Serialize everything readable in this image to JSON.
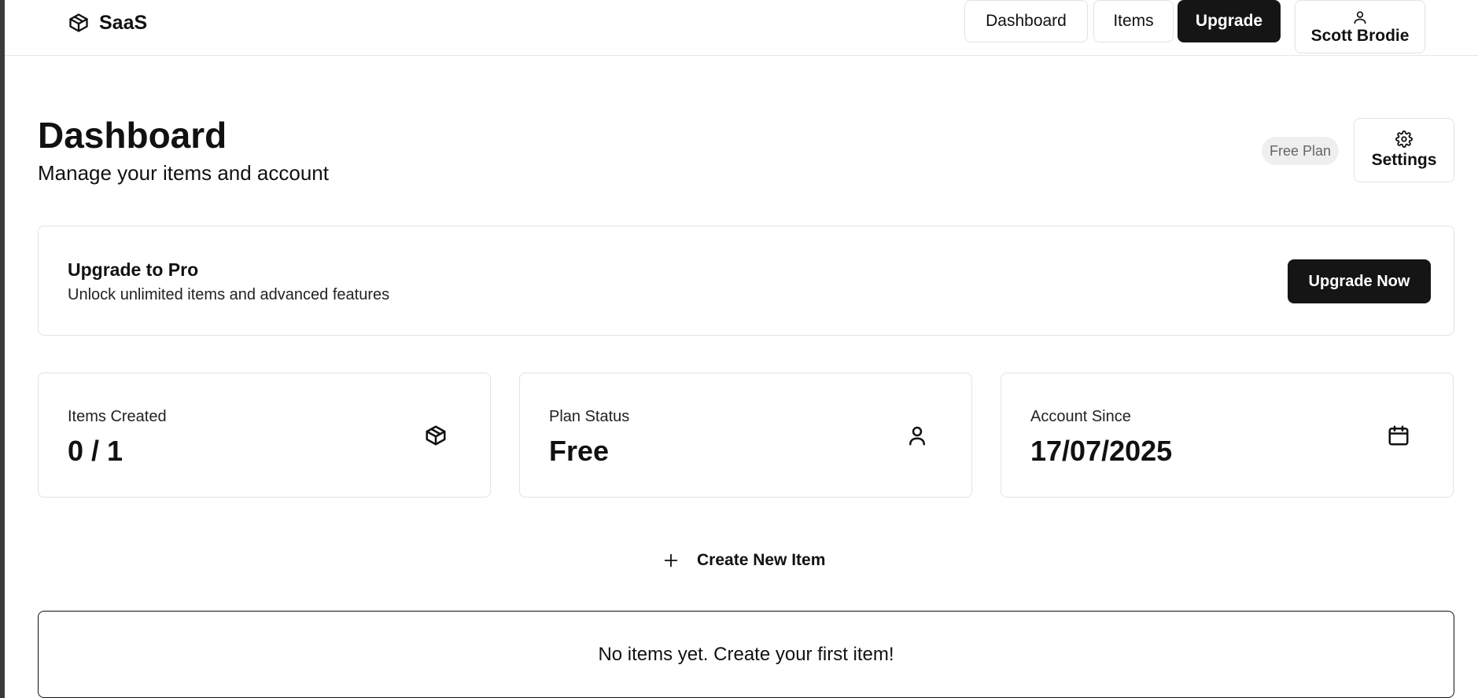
{
  "header": {
    "brand": "SaaS",
    "nav": {
      "dashboard": "Dashboard",
      "items": "Items",
      "upgrade": "Upgrade"
    },
    "user_name": "Scott Brodie"
  },
  "main": {
    "title": "Dashboard",
    "subtitle": "Manage your items and account",
    "plan_badge": "Free Plan",
    "settings_label": "Settings"
  },
  "upgrade_card": {
    "title": "Upgrade to Pro",
    "description": "Unlock unlimited items and advanced features",
    "button": "Upgrade Now"
  },
  "stats": [
    {
      "label": "Items Created",
      "value": "0 / 1",
      "icon": "package-icon"
    },
    {
      "label": "Plan Status",
      "value": "Free",
      "icon": "user-icon"
    },
    {
      "label": "Account Since",
      "value": "17/07/2025",
      "icon": "calendar-icon"
    }
  ],
  "create_button": "Create New Item",
  "empty_state": "No items yet. Create your first item!",
  "colors": {
    "primary": "#151515",
    "border": "#e3e3e3",
    "badge_bg": "#efefef",
    "badge_text": "#666666"
  }
}
